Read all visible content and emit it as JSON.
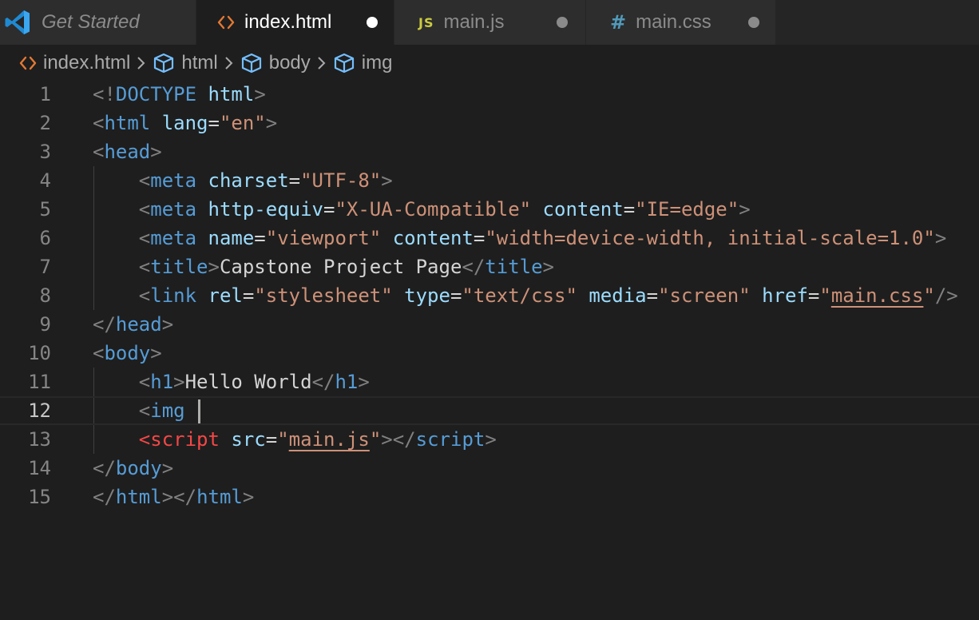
{
  "tabs": [
    {
      "label": "Get Started",
      "icon": "vscode-logo-icon",
      "italic": true,
      "active": false,
      "dirty": false
    },
    {
      "label": "index.html",
      "icon": "html-file-icon",
      "active": true,
      "dirty": true
    },
    {
      "label": "main.js",
      "icon": "js-file-icon",
      "icon_text": "JS",
      "active": false,
      "dirty": true
    },
    {
      "label": "main.css",
      "icon": "css-file-icon",
      "icon_text": "#",
      "active": false,
      "dirty": true
    }
  ],
  "breadcrumb": [
    {
      "label": "index.html",
      "icon": "html-file-icon"
    },
    {
      "label": "html",
      "icon": "element-cube-icon"
    },
    {
      "label": "body",
      "icon": "element-cube-icon"
    },
    {
      "label": "img",
      "icon": "element-cube-icon"
    }
  ],
  "editor": {
    "current_line": 12,
    "line_numbers": [
      "1",
      "2",
      "3",
      "4",
      "5",
      "6",
      "7",
      "8",
      "9",
      "10",
      "11",
      "12",
      "13",
      "14",
      "15"
    ],
    "lines": [
      [
        [
          "punc",
          "<!"
        ],
        [
          "tag",
          "DOCTYPE"
        ],
        [
          "text",
          " "
        ],
        [
          "attr",
          "html"
        ],
        [
          "punc",
          ">"
        ]
      ],
      [
        [
          "punc",
          "<"
        ],
        [
          "tag",
          "html"
        ],
        [
          "text",
          " "
        ],
        [
          "attr",
          "lang"
        ],
        [
          "text",
          "="
        ],
        [
          "str",
          "\"en\""
        ],
        [
          "punc",
          ">"
        ]
      ],
      [
        [
          "punc",
          "<"
        ],
        [
          "tag",
          "head"
        ],
        [
          "punc",
          ">"
        ]
      ],
      [
        [
          "text",
          "    "
        ],
        [
          "punc",
          "<"
        ],
        [
          "tag",
          "meta"
        ],
        [
          "text",
          " "
        ],
        [
          "attr",
          "charset"
        ],
        [
          "text",
          "="
        ],
        [
          "str",
          "\"UTF-8\""
        ],
        [
          "punc",
          ">"
        ]
      ],
      [
        [
          "text",
          "    "
        ],
        [
          "punc",
          "<"
        ],
        [
          "tag",
          "meta"
        ],
        [
          "text",
          " "
        ],
        [
          "attr",
          "http-equiv"
        ],
        [
          "text",
          "="
        ],
        [
          "str",
          "\"X-UA-Compatible\""
        ],
        [
          "text",
          " "
        ],
        [
          "attr",
          "content"
        ],
        [
          "text",
          "="
        ],
        [
          "str",
          "\"IE=edge\""
        ],
        [
          "punc",
          ">"
        ]
      ],
      [
        [
          "text",
          "    "
        ],
        [
          "punc",
          "<"
        ],
        [
          "tag",
          "meta"
        ],
        [
          "text",
          " "
        ],
        [
          "attr",
          "name"
        ],
        [
          "text",
          "="
        ],
        [
          "str",
          "\"viewport\""
        ],
        [
          "text",
          " "
        ],
        [
          "attr",
          "content"
        ],
        [
          "text",
          "="
        ],
        [
          "str",
          "\"width=device-width, initial-scale=1.0\""
        ],
        [
          "punc",
          ">"
        ]
      ],
      [
        [
          "text",
          "    "
        ],
        [
          "punc",
          "<"
        ],
        [
          "tag",
          "title"
        ],
        [
          "punc",
          ">"
        ],
        [
          "text",
          "Capstone Project Page"
        ],
        [
          "punc",
          "</"
        ],
        [
          "tag",
          "title"
        ],
        [
          "punc",
          ">"
        ]
      ],
      [
        [
          "text",
          "    "
        ],
        [
          "punc",
          "<"
        ],
        [
          "tag",
          "link"
        ],
        [
          "text",
          " "
        ],
        [
          "attr",
          "rel"
        ],
        [
          "text",
          "="
        ],
        [
          "str",
          "\"stylesheet\""
        ],
        [
          "text",
          " "
        ],
        [
          "attr",
          "type"
        ],
        [
          "text",
          "="
        ],
        [
          "str",
          "\"text/css\""
        ],
        [
          "text",
          " "
        ],
        [
          "attr",
          "media"
        ],
        [
          "text",
          "="
        ],
        [
          "str",
          "\"screen\""
        ],
        [
          "text",
          " "
        ],
        [
          "attr",
          "href"
        ],
        [
          "text",
          "="
        ],
        [
          "str",
          "\""
        ],
        [
          "link",
          "main.css"
        ],
        [
          "str",
          "\""
        ],
        [
          "punc",
          "/>"
        ]
      ],
      [
        [
          "punc",
          "</"
        ],
        [
          "tag",
          "head"
        ],
        [
          "punc",
          ">"
        ]
      ],
      [
        [
          "punc",
          "<"
        ],
        [
          "tag",
          "body"
        ],
        [
          "punc",
          ">"
        ]
      ],
      [
        [
          "text",
          "    "
        ],
        [
          "punc",
          "<"
        ],
        [
          "tag",
          "h1"
        ],
        [
          "punc",
          ">"
        ],
        [
          "text",
          "Hello World"
        ],
        [
          "punc",
          "</"
        ],
        [
          "tag",
          "h1"
        ],
        [
          "punc",
          ">"
        ]
      ],
      [
        [
          "text",
          "    "
        ],
        [
          "punc",
          "<"
        ],
        [
          "tag",
          "img"
        ],
        [
          "text",
          " "
        ],
        [
          "cursor",
          ""
        ]
      ],
      [
        [
          "text",
          "    "
        ],
        [
          "tagerr",
          "<script"
        ],
        [
          "text",
          " "
        ],
        [
          "attr",
          "src"
        ],
        [
          "text",
          "="
        ],
        [
          "str",
          "\""
        ],
        [
          "link",
          "main.js"
        ],
        [
          "str",
          "\""
        ],
        [
          "punc",
          "></"
        ],
        [
          "tag",
          "script"
        ],
        [
          "punc",
          ">"
        ]
      ],
      [
        [
          "punc",
          "</"
        ],
        [
          "tag",
          "body"
        ],
        [
          "punc",
          ">"
        ]
      ],
      [
        [
          "punc",
          "</"
        ],
        [
          "tag",
          "html"
        ],
        [
          "punc",
          "></"
        ],
        [
          "tag",
          "html"
        ],
        [
          "punc",
          ">"
        ]
      ]
    ]
  },
  "colors": {
    "tag": "#569cd6",
    "attr": "#9cdcfe",
    "string": "#ce9178",
    "punctuation": "#808080",
    "error_tag": "#f44747",
    "background": "#1e1e1e"
  }
}
